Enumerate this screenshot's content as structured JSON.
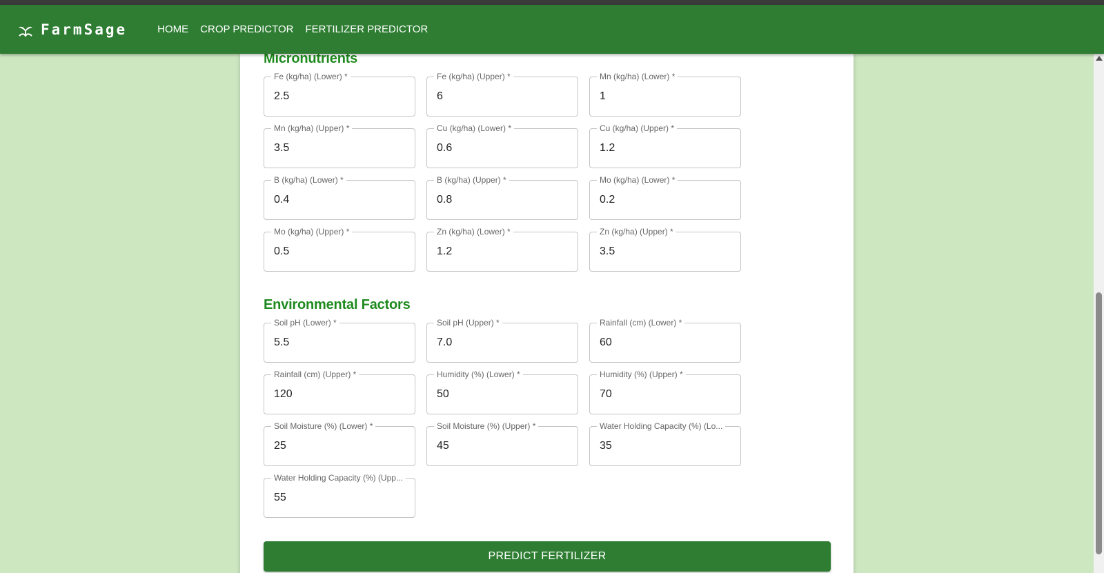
{
  "navbar": {
    "brand": "FarmSage",
    "links": [
      "HOME",
      "CROP PREDICTOR",
      "FERTILIZER PREDICTOR"
    ]
  },
  "colors": {
    "primary": "#2e7d32",
    "section_title": "#1e8a1e",
    "background": "#cde7c1"
  },
  "micronutrients": {
    "title": "Micronutrients",
    "fields": [
      {
        "label": "Fe (kg/ha) (Lower) *",
        "value": "2.5"
      },
      {
        "label": "Fe (kg/ha) (Upper) *",
        "value": "6"
      },
      {
        "label": "Mn (kg/ha) (Lower) *",
        "value": "1"
      },
      {
        "label": "Mn (kg/ha) (Upper) *",
        "value": "3.5"
      },
      {
        "label": "Cu (kg/ha) (Lower) *",
        "value": "0.6"
      },
      {
        "label": "Cu (kg/ha) (Upper) *",
        "value": "1.2"
      },
      {
        "label": "B (kg/ha) (Lower) *",
        "value": "0.4"
      },
      {
        "label": "B (kg/ha) (Upper) *",
        "value": "0.8"
      },
      {
        "label": "Mo (kg/ha) (Lower) *",
        "value": "0.2"
      },
      {
        "label": "Mo (kg/ha) (Upper) *",
        "value": "0.5"
      },
      {
        "label": "Zn (kg/ha) (Lower) *",
        "value": "1.2"
      },
      {
        "label": "Zn (kg/ha) (Upper) *",
        "value": "3.5"
      }
    ]
  },
  "environmental": {
    "title": "Environmental Factors",
    "fields": [
      {
        "label": "Soil pH (Lower) *",
        "value": "5.5"
      },
      {
        "label": "Soil pH (Upper) *",
        "value": "7.0"
      },
      {
        "label": "Rainfall (cm) (Lower) *",
        "value": "60"
      },
      {
        "label": "Rainfall (cm) (Upper) *",
        "value": "120"
      },
      {
        "label": "Humidity (%) (Lower) *",
        "value": "50"
      },
      {
        "label": "Humidity (%) (Upper) *",
        "value": "70"
      },
      {
        "label": "Soil Moisture (%) (Lower) *",
        "value": "25"
      },
      {
        "label": "Soil Moisture (%) (Upper) *",
        "value": "45"
      },
      {
        "label": "Water Holding Capacity (%) (Lo...",
        "value": "35"
      },
      {
        "label": "Water Holding Capacity (%) (Upp...",
        "value": "55"
      }
    ]
  },
  "predict_button": "PREDICT FERTILIZER"
}
